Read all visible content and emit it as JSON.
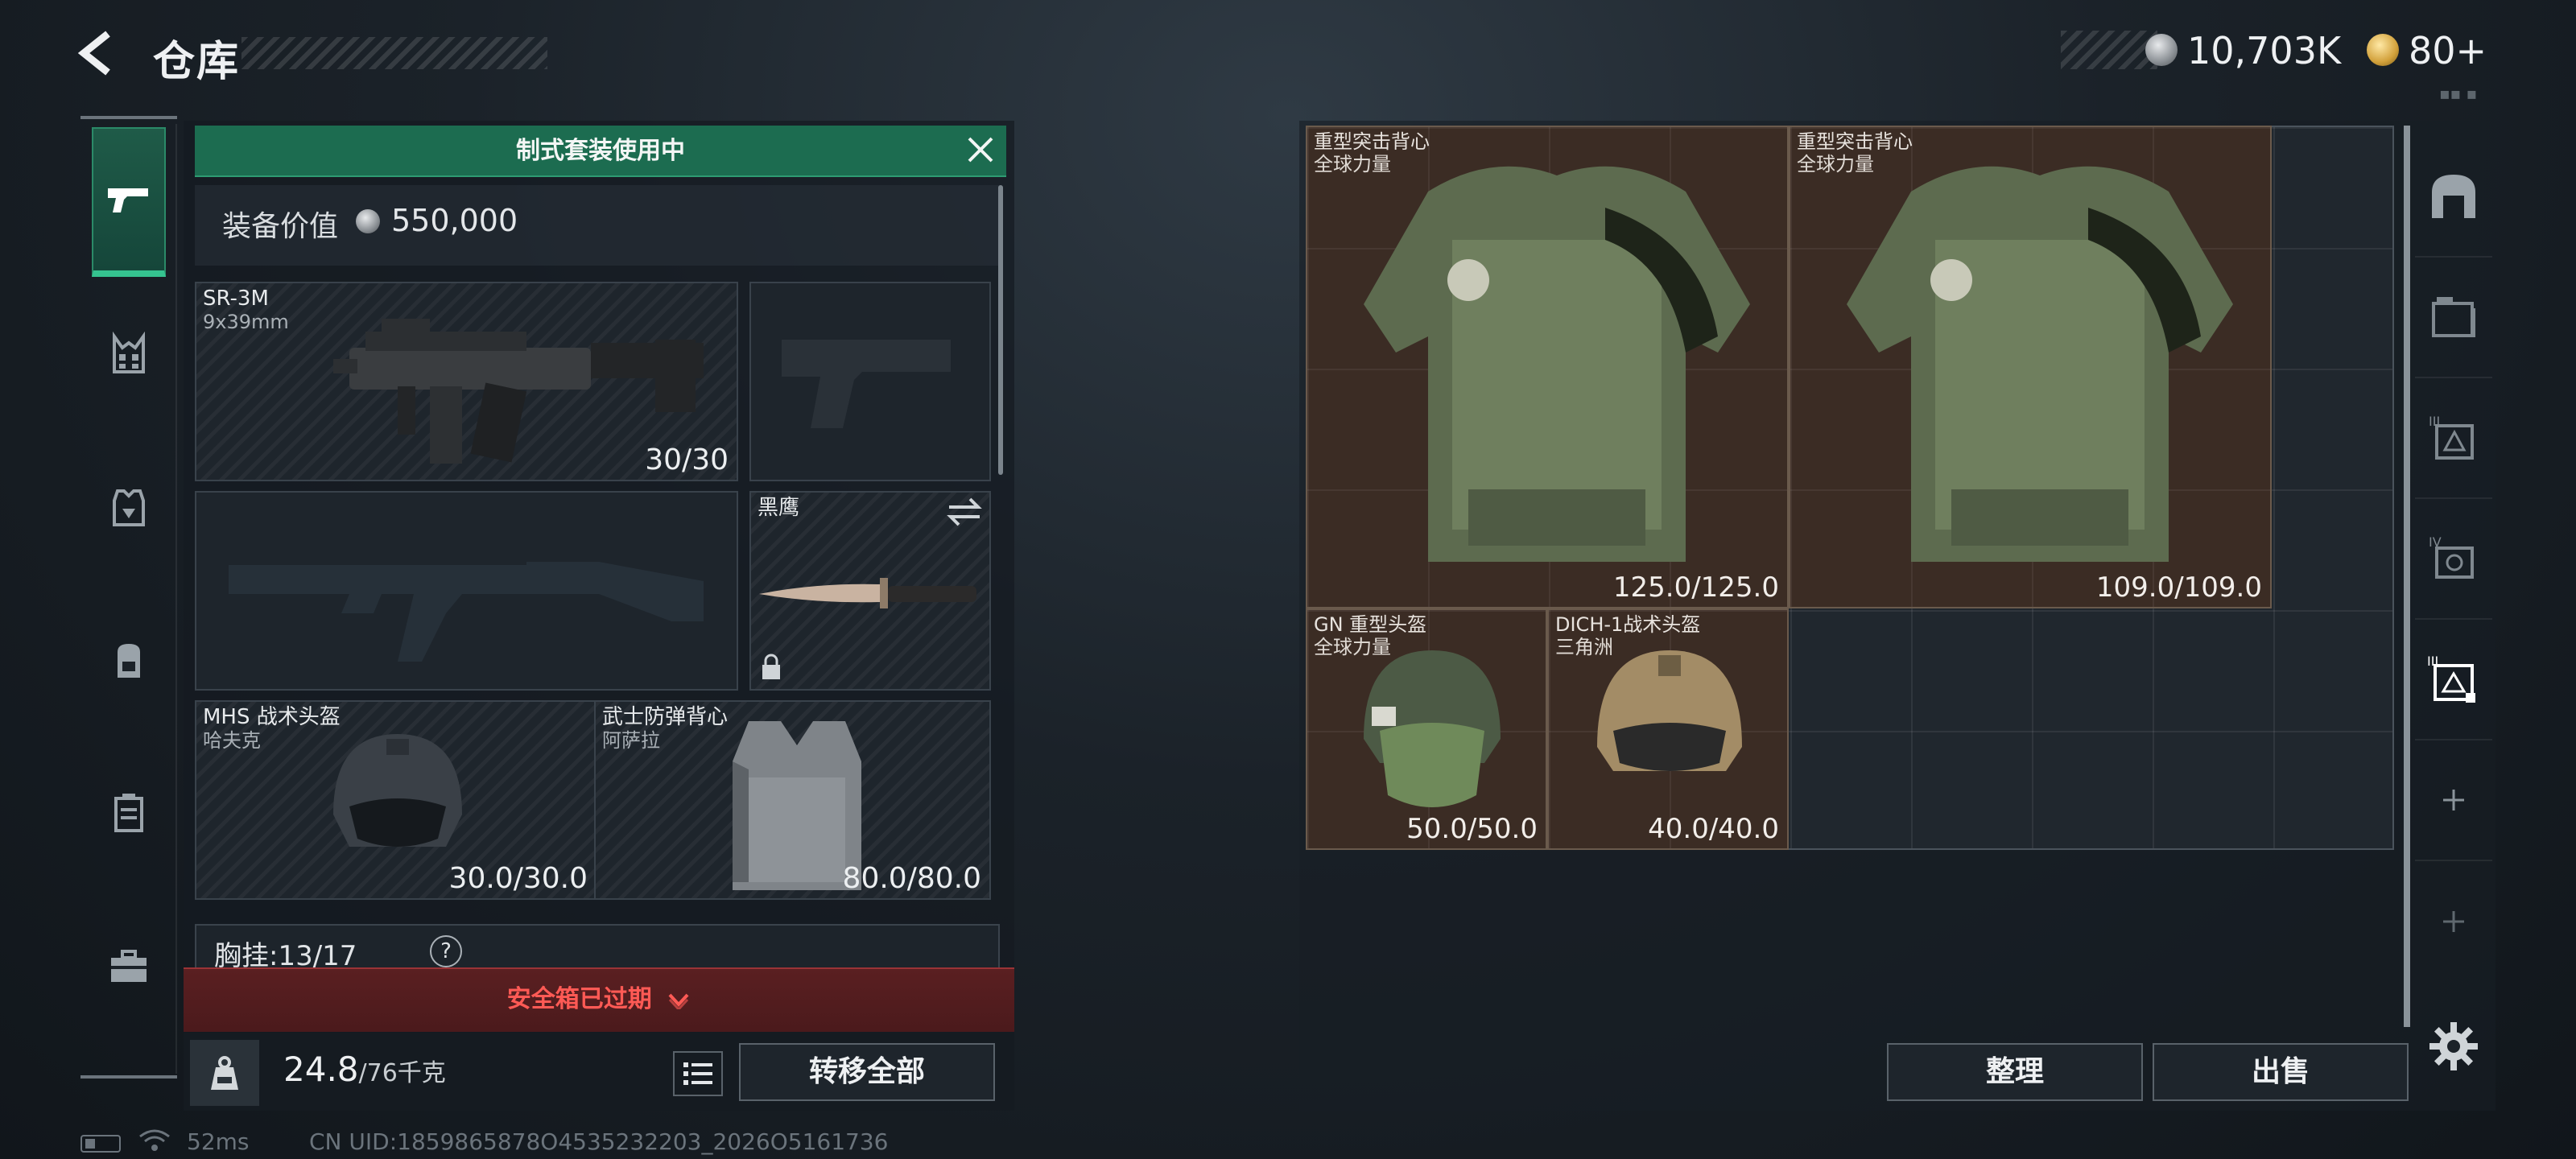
{
  "header": {
    "title": "仓库",
    "currencies": [
      {
        "name": "silver-coin",
        "value": "10,703K"
      },
      {
        "name": "gold-coin",
        "value": "80+"
      }
    ]
  },
  "left_nav": {
    "items": [
      {
        "icon": "pistol-icon",
        "active": true
      },
      {
        "icon": "chest-rig-icon",
        "active": false
      },
      {
        "icon": "armor-icon",
        "active": false
      },
      {
        "icon": "backpack-icon",
        "active": false
      },
      {
        "icon": "case-icon",
        "active": false
      },
      {
        "icon": "toolbox-icon",
        "active": false
      }
    ]
  },
  "loadout": {
    "kit_banner": "制式套装使用中",
    "equip_value_label": "装备价值",
    "equip_value": "550,000",
    "slots": {
      "primary": {
        "name": "SR-3M",
        "sub": "9x39mm",
        "durability": "30/30"
      },
      "melee": {
        "name": "黑鹰"
      },
      "helmet": {
        "name": "MHS 战术头盔",
        "sub": "哈夫克",
        "durability": "30.0/30.0"
      },
      "armor": {
        "name": "武士防弹背心",
        "sub": "阿萨拉",
        "durability": "80.0/80.0"
      }
    },
    "chest_rig_label": "胸挂:13/17",
    "chest_rig_help": "?",
    "safebox_status": "安全箱已过期",
    "weight_value": "24.8",
    "weight_max": "/76千克",
    "transfer_all": "转移全部"
  },
  "storage": {
    "items": [
      {
        "name": "重型突击背心",
        "sub": "全球力量",
        "durability": "125.0/125.0"
      },
      {
        "name": "重型突击背心",
        "sub": "全球力量",
        "durability": "109.0/109.0"
      },
      {
        "name": "GN 重型头盔",
        "sub": "全球力量",
        "durability": "50.0/50.0"
      },
      {
        "name": "DICH-1战术头盔",
        "sub": "三角洲",
        "durability": "40.0/40.0"
      }
    ],
    "sort_label": "整理",
    "sell_label": "出售"
  },
  "status_bar": {
    "ping": "52ms",
    "uid": "CN UID:1859865878O4535232203_2026O5161736"
  },
  "colors": {
    "banner_green": "#1c6c50",
    "alert_red": "#ff5a55",
    "item_brown": "#3b2c24"
  }
}
